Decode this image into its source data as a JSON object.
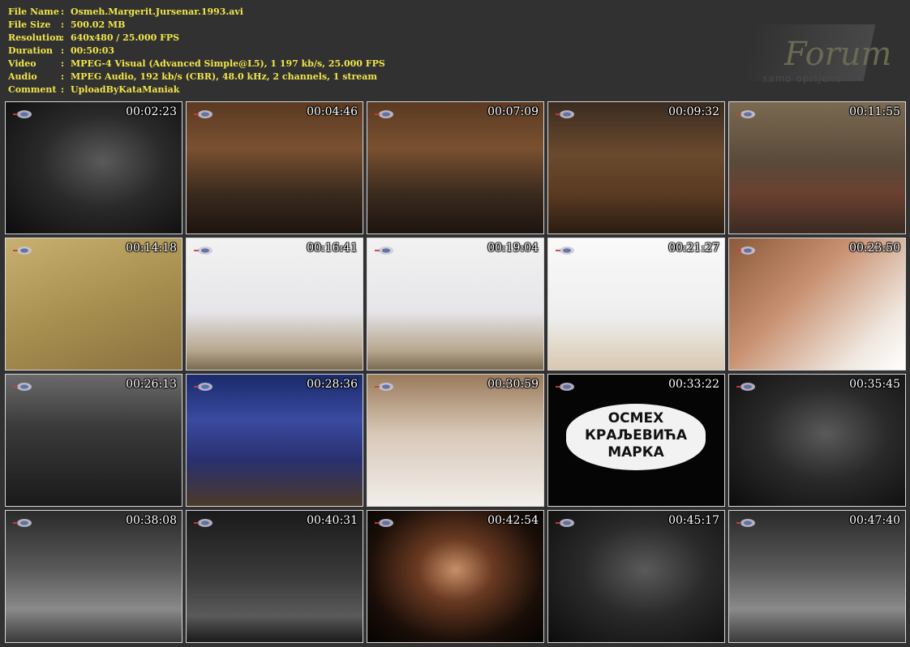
{
  "info": [
    {
      "label": "File Name",
      "value": "Osmeh.Margerit.Jursenar.1993.avi"
    },
    {
      "label": "File Size",
      "value": "500.02 MB"
    },
    {
      "label": "Resolution",
      "value": "640x480 / 25.000 FPS"
    },
    {
      "label": "Duration",
      "value": "00:50:03"
    },
    {
      "label": "Video",
      "value": "MPEG-4 Visual (Advanced Simple@L5), 1 197 kb/s, 25.000 FPS"
    },
    {
      "label": "Audio",
      "value": "MPEG Audio, 192 kb/s (CBR), 48.0 kHz, 2 channels, 1 stream"
    },
    {
      "label": "Comment",
      "value": "UploadByKataManiak"
    }
  ],
  "separator": ":",
  "watermark": {
    "text": "Forum",
    "subtext": "samo oprljeno"
  },
  "title_card": {
    "lines": [
      "ОСМЕХ",
      "КРАЉЕВИЋА",
      "МАРКА"
    ]
  },
  "thumbnails": [
    {
      "time": "00:02:23",
      "tone": "bw-dark"
    },
    {
      "time": "00:04:46",
      "tone": "warm-interior"
    },
    {
      "time": "00:07:09",
      "tone": "warm-interior"
    },
    {
      "time": "00:09:32",
      "tone": "library"
    },
    {
      "time": "00:11:55",
      "tone": "outdoor"
    },
    {
      "time": "00:14:18",
      "tone": "sepia"
    },
    {
      "time": "00:16:41",
      "tone": "white-deck"
    },
    {
      "time": "00:19:04",
      "tone": "white-deck"
    },
    {
      "time": "00:21:27",
      "tone": "white-bright"
    },
    {
      "time": "00:23:50",
      "tone": "portrait"
    },
    {
      "time": "00:26:13",
      "tone": "bw-room"
    },
    {
      "time": "00:28:36",
      "tone": "blue-stage"
    },
    {
      "time": "00:30:59",
      "tone": "portrait-light"
    },
    {
      "time": "00:33:22",
      "tone": "title"
    },
    {
      "time": "00:35:45",
      "tone": "bw-dark"
    },
    {
      "time": "00:38:08",
      "tone": "bw-mid"
    },
    {
      "time": "00:40:31",
      "tone": "bw-stage"
    },
    {
      "time": "00:42:54",
      "tone": "dark-portrait"
    },
    {
      "time": "00:45:17",
      "tone": "bw-dark"
    },
    {
      "time": "00:47:40",
      "tone": "bw-mid"
    }
  ]
}
